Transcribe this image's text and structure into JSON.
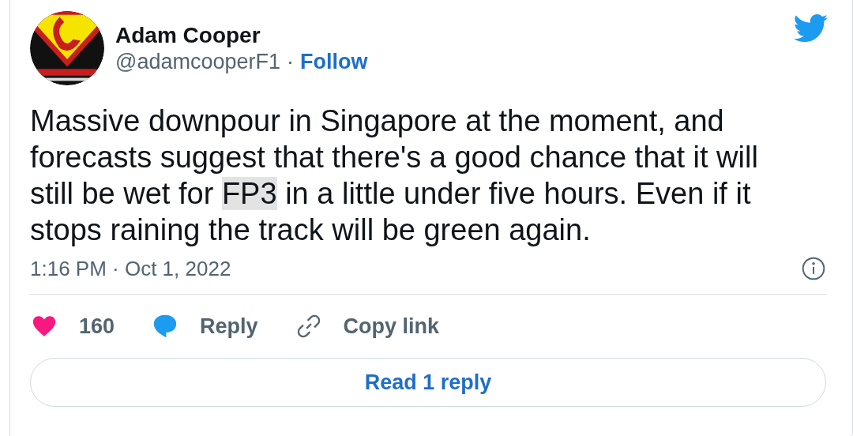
{
  "author": {
    "name": "Adam Cooper",
    "handle": "@adamcooperF1",
    "separator": "·",
    "follow": "Follow"
  },
  "text": [
    {
      "text": "Massive downpour in Singapore at the moment, and forecasts suggest that there's a good chance that it will still be wet for ",
      "highlighted": false
    },
    {
      "text": "FP3",
      "highlighted": true
    },
    {
      "text": " in a little under five hours. Even if it stops raining the track will be green again.",
      "highlighted": false
    }
  ],
  "timestamp": "1:16 PM · Oct 1, 2022",
  "actions": [
    {
      "kind": "like",
      "label": "160"
    },
    {
      "kind": "reply",
      "label": "Reply"
    },
    {
      "kind": "copy",
      "label": "Copy link"
    }
  ],
  "read_replies": "Read 1 reply"
}
